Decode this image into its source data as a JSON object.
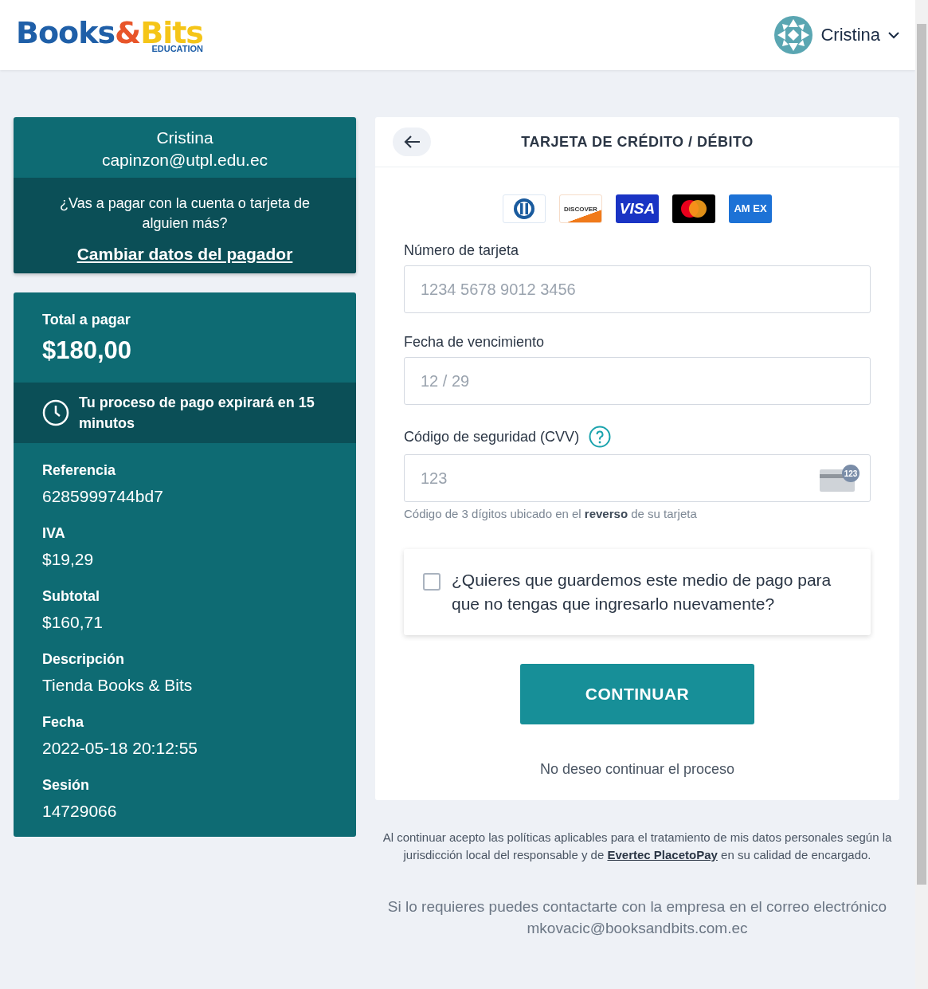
{
  "header": {
    "logo": {
      "words": [
        "Books",
        "&",
        "Bits"
      ],
      "tagline": "EDUCATION"
    },
    "user": {
      "name": "Cristina"
    }
  },
  "payer": {
    "name": "Cristina",
    "email": "capinzon@utpl.edu.ec",
    "question": "¿Vas a pagar con la cuenta o tarjeta de alguien más?",
    "change_link": "Cambiar datos del pagador"
  },
  "summary": {
    "total_label": "Total a pagar",
    "total": "$180,00",
    "timer": "Tu proceso de pago expirará en 15 minutos",
    "fields": [
      {
        "label": "Referencia",
        "value": "6285999744bd7"
      },
      {
        "label": "IVA",
        "value": "$19,29"
      },
      {
        "label": "Subtotal",
        "value": "$160,71"
      },
      {
        "label": "Descripción",
        "value": "Tienda Books & Bits"
      },
      {
        "label": "Fecha",
        "value": "2022-05-18 20:12:55"
      },
      {
        "label": "Sesión",
        "value": "14729066"
      }
    ]
  },
  "payment": {
    "title": "TARJETA DE CRÉDITO / DÉBITO",
    "card_brands": [
      {
        "kind": "diners"
      },
      {
        "kind": "discover",
        "label": "DISCOVER"
      },
      {
        "kind": "visa",
        "label": "VISA"
      },
      {
        "kind": "mastercard"
      },
      {
        "kind": "amex",
        "label": "AM EX"
      }
    ],
    "fields": [
      {
        "label": "Número de tarjeta",
        "placeholder": "1234 5678 9012 3456"
      },
      {
        "label": "Fecha de vencimiento",
        "placeholder": "12 / 29"
      },
      {
        "label": "Código de seguridad (CVV)",
        "placeholder": "123",
        "help": true,
        "card_badge": "123",
        "hint": "Código de 3 dígitos ubicado en el **reverso** de su tarjeta"
      }
    ],
    "save_option": {
      "label": "¿Quieres que guardemos este medio de pago para que no tengas que ingresarlo nuevamente?",
      "checked": false
    },
    "continue_button": "CONTINUAR",
    "cancel_link": "No deseo continuar el proceso"
  },
  "legal": {
    "before": "Al continuar acepto las políticas aplicables para el tratamiento de mis datos personales según la jurisdicción local del responsable y de",
    "link": "Evertec PlacetoPay",
    "after": "en su calidad de encargado."
  },
  "contact": {
    "text": "Si lo requieres puedes contactarte con la empresa en el correo electrónico",
    "email": "mkovacic@booksandbits.com.ec"
  }
}
